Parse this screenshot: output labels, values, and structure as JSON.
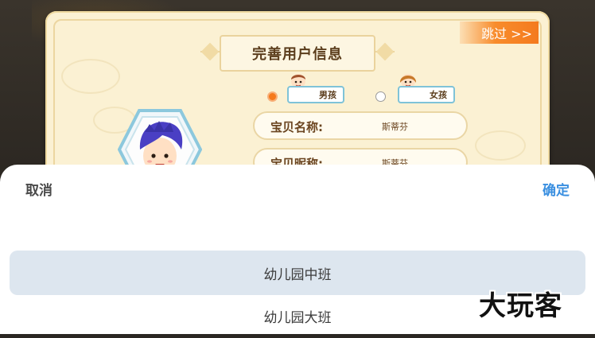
{
  "form": {
    "title": "完善用户信息",
    "skip_label": "跳过 >>",
    "gender": {
      "boy_label": "男孩",
      "girl_label": "女孩",
      "selected": "boy"
    },
    "baby_name": {
      "label": "宝贝名称:",
      "value": "斯蒂芬"
    },
    "baby_nickname": {
      "label": "宝贝昵称:",
      "value": "斯蒂芬"
    }
  },
  "picker": {
    "cancel_label": "取消",
    "confirm_label": "确定",
    "options": [
      "幼儿园中班",
      "幼儿园大班"
    ],
    "selected_option": "幼儿园中班"
  },
  "watermark": "大玩客",
  "colors": {
    "accent_blue": "#3a8fe0",
    "accent_orange": "#f57a1c",
    "selected_row": "#dde6ef"
  }
}
